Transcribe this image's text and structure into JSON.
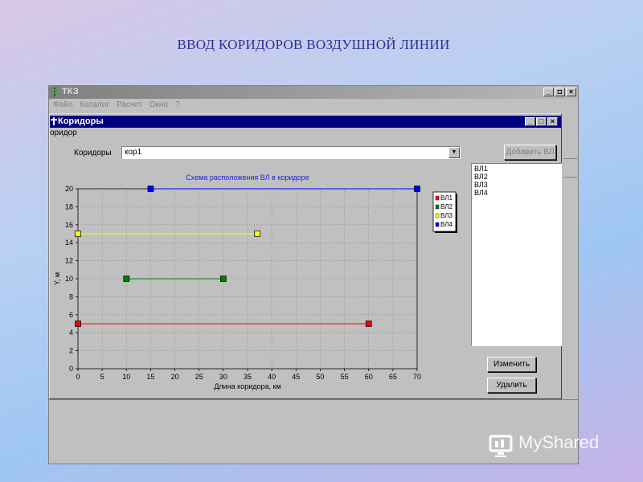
{
  "slide": {
    "title": "ВВОД КОРИДОРОВ ВОЗДУШНОЙ ЛИНИИ"
  },
  "app": {
    "title": "ТКЗ",
    "menu": [
      "Файл",
      "Каталог",
      "Расчет",
      "Окно",
      "?"
    ]
  },
  "window": {
    "title": "Коридоры",
    "menu_label": "оридор",
    "corridors_label": "Коридоры",
    "corridor_value": "кор1",
    "add_button": "Добавить ВЛ",
    "change_button": "Изменить",
    "delete_button": "Удалить",
    "list_items": [
      "ВЛ1",
      "ВЛ2",
      "ВЛ3",
      "ВЛ4"
    ]
  },
  "watermark": {
    "text": "MyShared"
  },
  "colors": {
    "series": [
      "#ff0000",
      "#008000",
      "#ffff00",
      "#0000ff"
    ],
    "chart_title": "#1f1fd0"
  },
  "chart_data": {
    "type": "line",
    "title": "Схема расположения ВЛ в коридоре",
    "xlabel": "Длина коридора, км",
    "ylabel": "Y, м",
    "xlim": [
      0,
      70
    ],
    "ylim": [
      0,
      20
    ],
    "xticks": [
      0,
      5,
      10,
      15,
      20,
      25,
      30,
      35,
      40,
      45,
      50,
      55,
      60,
      65,
      70
    ],
    "yticks": [
      0,
      2,
      4,
      6,
      8,
      10,
      12,
      14,
      16,
      18,
      20
    ],
    "grid": true,
    "legend": "right",
    "series": [
      {
        "name": "ВЛ1",
        "x": [
          0,
          60
        ],
        "y": [
          5,
          5
        ]
      },
      {
        "name": "ВЛ2",
        "x": [
          10,
          30
        ],
        "y": [
          10,
          10
        ]
      },
      {
        "name": "ВЛ3",
        "x": [
          0,
          37
        ],
        "y": [
          15,
          15
        ]
      },
      {
        "name": "ВЛ4",
        "x": [
          15,
          70
        ],
        "y": [
          20,
          20
        ]
      }
    ]
  }
}
